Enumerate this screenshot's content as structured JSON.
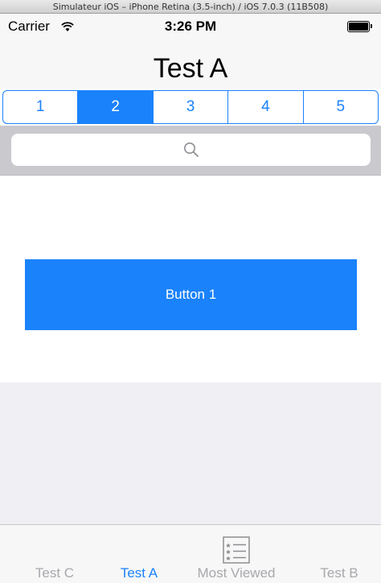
{
  "window": {
    "title": "Simulateur iOS – iPhone Retina (3.5-inch) / iOS 7.0.3 (11B508)"
  },
  "status_bar": {
    "carrier": "Carrier",
    "time": "3:26 PM"
  },
  "nav": {
    "title": "Test A"
  },
  "segmented": {
    "items": [
      {
        "label": "1",
        "selected": false
      },
      {
        "label": "2",
        "selected": true
      },
      {
        "label": "3",
        "selected": false
      },
      {
        "label": "4",
        "selected": false
      },
      {
        "label": "5",
        "selected": false
      }
    ]
  },
  "search": {
    "placeholder": ""
  },
  "content": {
    "button_label": "Button 1"
  },
  "tabs": [
    {
      "label": "Test C",
      "active": false
    },
    {
      "label": "Test A",
      "active": true
    },
    {
      "label": "Most Viewed",
      "active": false,
      "icon": "list-icon"
    },
    {
      "label": "Test B",
      "active": false
    }
  ],
  "colors": {
    "accent": "#1a82fb",
    "tab_inactive": "#a8a8ad",
    "background_gray": "#efeff4",
    "search_bar": "#c9c9ce"
  }
}
